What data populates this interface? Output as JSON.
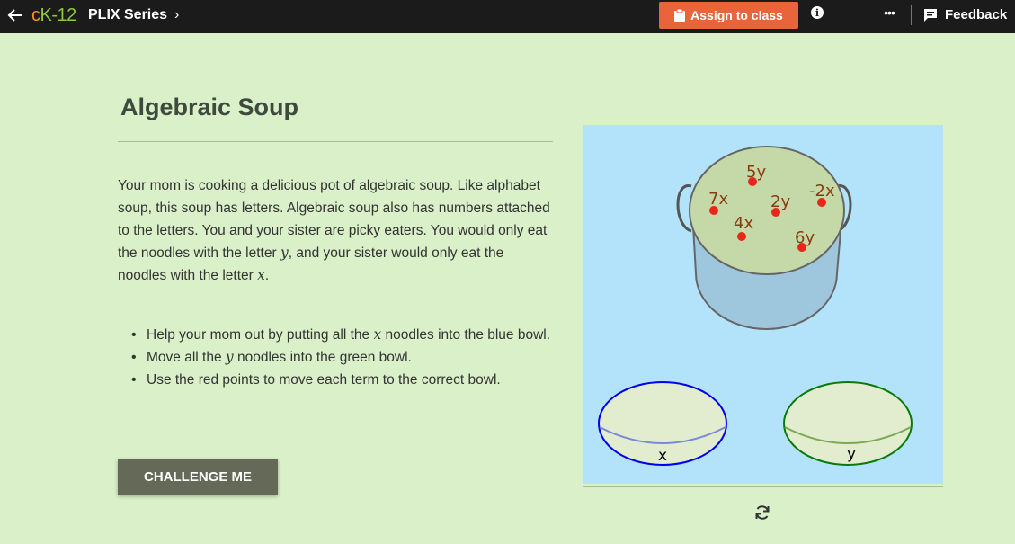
{
  "topbar": {
    "logo_c": "c",
    "logo_k": "K-12",
    "series_label": "PLIX Series",
    "series_chevron": "›",
    "assign_label": "Assign to class",
    "info_glyph": "i",
    "more_glyph": "•••",
    "feedback_label": "Feedback"
  },
  "main": {
    "title": "Algebraic Soup",
    "intro_1": "Your mom is cooking a delicious pot of algebraic soup. Like alphabet soup, this soup has letters.  Algebraic soup also has numbers attached to the letters.  You and your sister are picky eaters. You would only eat the noodles with the letter ",
    "intro_var_y": "y",
    "intro_2": ", and your sister would only eat the noodles with the letter ",
    "intro_var_x": "x",
    "intro_3": ".",
    "bullet_1a": "Help your mom out by putting all the ",
    "bullet_1_var": "x",
    "bullet_1b": " noodles into the blue bowl.",
    "bullet_2a": "Move all the ",
    "bullet_2_var": "y",
    "bullet_2b": " noodles into the green bowl.",
    "bullet_3": "Use the red points to move each term to the correct bowl.",
    "challenge_label": "CHALLENGE ME"
  },
  "interactive": {
    "terms": [
      "5y",
      "7x",
      "2y",
      "-2x",
      "4x",
      "6y"
    ],
    "bowl_x_label": "x",
    "bowl_y_label": "y",
    "colors": {
      "background": "#b3e3fa",
      "pot": "#c5d9a8",
      "point": "#e8271b",
      "term_text": "#8b3a0e",
      "bowl_x_border": "#0000ee",
      "bowl_y_border": "#0a7a0a"
    },
    "reset_icon": "refresh-icon"
  }
}
